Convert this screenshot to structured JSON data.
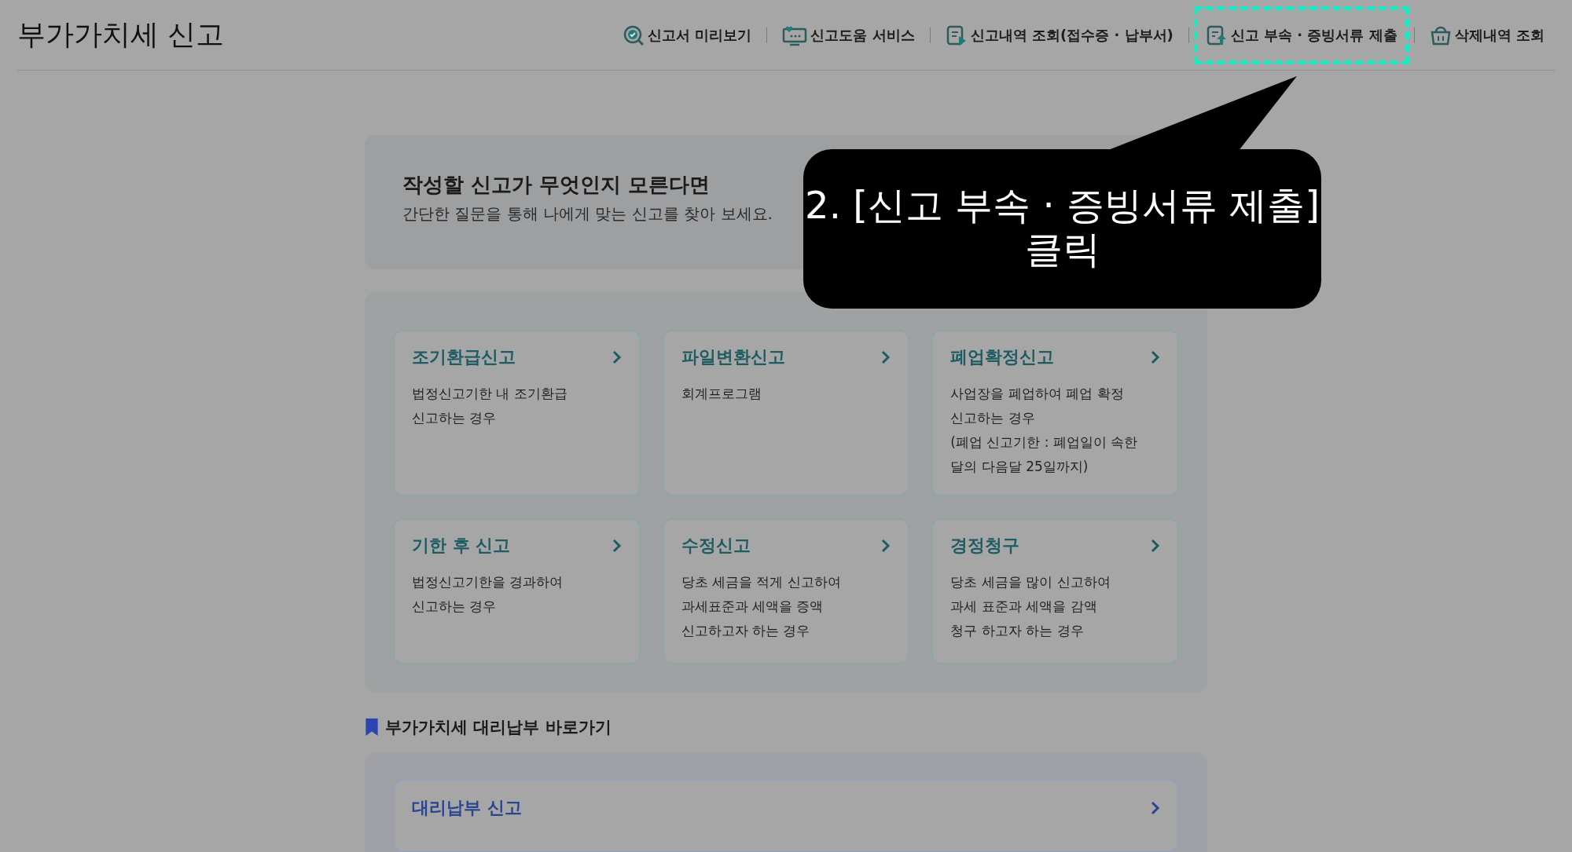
{
  "page_title": "부가가치세 신고",
  "nav": [
    {
      "label": "신고서 미리보기",
      "kind": "preview",
      "highlighted": false
    },
    {
      "label": "신고도움 서비스",
      "kind": "help",
      "highlighted": false
    },
    {
      "label": "신고내역 조회(접수증 · 납부서)",
      "kind": "history",
      "highlighted": false
    },
    {
      "label": "신고 부속 · 증빙서류 제출",
      "kind": "attach",
      "highlighted": true
    },
    {
      "label": "삭제내역 조회",
      "kind": "trash",
      "highlighted": false
    }
  ],
  "intro": {
    "title": "작성할 신고가 무엇인지 모른다면",
    "description": "간단한 질문을 통해 나에게 맞는 신고를 찾아 보세요."
  },
  "cards": [
    {
      "title": "조기환급신고",
      "lines": [
        "법정신고기한 내 조기환급",
        "신고하는 경우"
      ]
    },
    {
      "title": "파일변환신고",
      "lines": [
        "회계프로그램"
      ]
    },
    {
      "title": "폐업확정신고",
      "lines": [
        "사업장을 폐업하여 폐업 확정",
        "신고하는 경우",
        "(폐업 신고기한 : 폐업일이 속한",
        "달의 다음달 25일까지)"
      ]
    },
    {
      "title": "기한 후 신고",
      "lines": [
        "법정신고기한을 경과하여",
        "신고하는 경우"
      ]
    },
    {
      "title": "수정신고",
      "lines": [
        "당초 세금을 적게 신고하여",
        "과세표준과 세액을 증액",
        "신고하고자 하는 경우"
      ]
    },
    {
      "title": "경정청구",
      "lines": [
        "당초 세금을 많이 신고하여",
        "과세 표준과 세액을 감액",
        "청구 하고자 하는 경우"
      ]
    }
  ],
  "proxy_section": {
    "title": "부가가치세 대리납부 바로가기",
    "card_title": "대리납부 신고"
  },
  "callout": {
    "lines": [
      "2. [신고 부속 · 증빙서류 제출]",
      "클릭"
    ]
  }
}
